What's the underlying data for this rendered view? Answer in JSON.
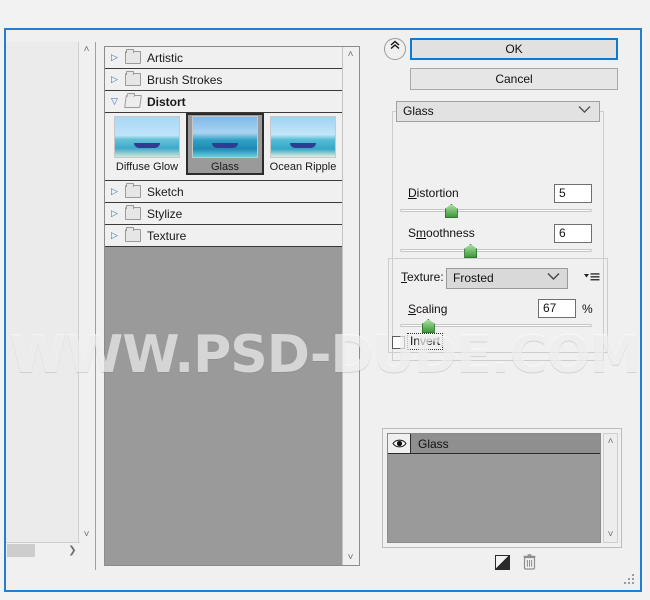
{
  "watermark": "WWW.PSD-DUDE.COM",
  "preview": {
    "name": "filter-preview",
    "scroll_up_icon": "˄",
    "scroll_down_icon": "˅",
    "scroll_right_icon": "❯"
  },
  "filter_list": {
    "scroll_up_icon": "˄",
    "scroll_down_icon": "˅",
    "categories": [
      {
        "label": "Artistic",
        "expanded": false
      },
      {
        "label": "Brush Strokes",
        "expanded": false
      },
      {
        "label": "Distort",
        "expanded": true
      },
      {
        "label": "Sketch",
        "expanded": false
      },
      {
        "label": "Stylize",
        "expanded": false
      },
      {
        "label": "Texture",
        "expanded": false
      }
    ],
    "distort_filters": [
      {
        "label": "Diffuse Glow",
        "selected": false
      },
      {
        "label": "Glass",
        "selected": true
      },
      {
        "label": "Ocean Ripple",
        "selected": false
      }
    ]
  },
  "buttons": {
    "ok": "OK",
    "cancel": "Cancel",
    "collapse_icon": "«"
  },
  "settings": {
    "filter_name": "Glass",
    "dropdown_chevron": "⌄",
    "distortion": {
      "label": "Distortion",
      "value": "5",
      "percent": 26
    },
    "smoothness": {
      "label": "Smoothness",
      "value": "6",
      "percent": 36
    },
    "texture": {
      "label": "Texture:",
      "value": "Frosted"
    },
    "scaling": {
      "label": "Scaling",
      "value": "67",
      "unit": "%",
      "percent": 14
    },
    "invert": {
      "label": "Invert",
      "checked": false
    }
  },
  "layer_panel": {
    "layer_name": "Glass",
    "visibility_icon": "◉",
    "scroll_up_icon": "˄",
    "scroll_down_icon": "˅",
    "new_effect_layer_label": "new-effect-layer",
    "delete_effect_layer_label": "delete-effect-layer"
  },
  "colors": {
    "dialog_border": "#1f7fd4",
    "accent_blue": "#0f7ad4",
    "panel_bg": "#f0f0f0",
    "list_bg": "#9a9a9a",
    "slider_green": "#3f9a3c"
  }
}
